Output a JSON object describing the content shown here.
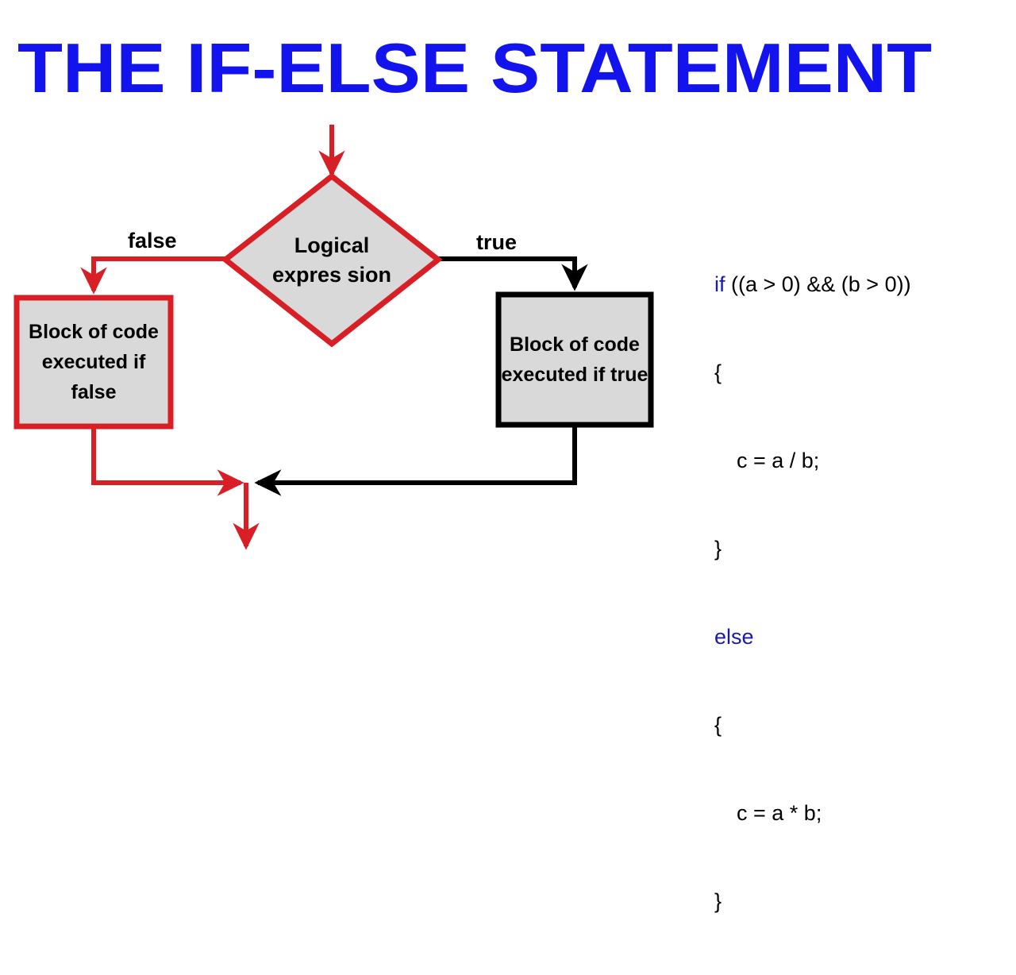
{
  "page": {
    "title": "THE IF-ELSE STATEMENT",
    "background_color": "#FFFFFF",
    "title_color": "#1313EE"
  },
  "colors": {
    "red": "#D81F26",
    "black": "#000000",
    "node_fill": "#D9D9D9",
    "keyword_blue": "#1A1AA8",
    "title_blue": "#1313EE"
  },
  "flowchart": {
    "type": "if-else control flow",
    "nodes": [
      {
        "id": "decision",
        "shape": "diamond",
        "label": "Logical expres sion",
        "lines": [
          "Logical",
          "expres",
          "sion"
        ],
        "border_color": "#D81F26",
        "fill_color": "#D9D9D9"
      },
      {
        "id": "false-block",
        "shape": "rectangle",
        "label": "Block of code executed if false",
        "lines": [
          "Block of",
          "code",
          "executed if",
          "false"
        ],
        "border_color": "#D81F26",
        "fill_color": "#D9D9D9"
      },
      {
        "id": "true-block",
        "shape": "rectangle",
        "label": "Block of code executed if true",
        "lines": [
          "Block of",
          "code",
          "executed if",
          "true"
        ],
        "border_color": "#000000",
        "fill_color": "#D9D9D9"
      }
    ],
    "edges": [
      {
        "id": "entry",
        "from": "start",
        "to": "decision",
        "label": "",
        "color": "#D81F26"
      },
      {
        "id": "false-branch",
        "from": "decision",
        "to": "false-block",
        "label": "false",
        "color": "#D81F26"
      },
      {
        "id": "true-branch",
        "from": "decision",
        "to": "true-block",
        "label": "true",
        "color": "#000000"
      },
      {
        "id": "false-merge",
        "from": "false-block",
        "to": "merge",
        "label": "",
        "color": "#D81F26"
      },
      {
        "id": "true-merge",
        "from": "true-block",
        "to": "merge",
        "label": "",
        "color": "#000000"
      },
      {
        "id": "exit",
        "from": "merge",
        "to": "end",
        "label": "",
        "color": "#D81F26"
      }
    ],
    "labels": {
      "false": "false",
      "true": "true"
    }
  },
  "code": {
    "language": "C",
    "lines": [
      {
        "keyword": "if",
        "rest": " ((a > 0) && (b > 0))",
        "indent": false
      },
      {
        "keyword": "",
        "rest": "{",
        "indent": false
      },
      {
        "keyword": "",
        "rest": "c = a / b;",
        "indent": true
      },
      {
        "keyword": "",
        "rest": "}",
        "indent": false
      },
      {
        "keyword": "else",
        "rest": "",
        "indent": false
      },
      {
        "keyword": "",
        "rest": "{",
        "indent": false
      },
      {
        "keyword": "",
        "rest": "c = a * b;",
        "indent": true
      },
      {
        "keyword": "",
        "rest": "}",
        "indent": false
      }
    ],
    "line1_keyword": "if",
    "line1_rest": " ((a > 0) && (b > 0))",
    "line2": "{",
    "line3": "c = a / b;",
    "line4": "}",
    "line5_keyword": "else",
    "line6": "{",
    "line7": "c = a * b;",
    "line8": "}"
  }
}
